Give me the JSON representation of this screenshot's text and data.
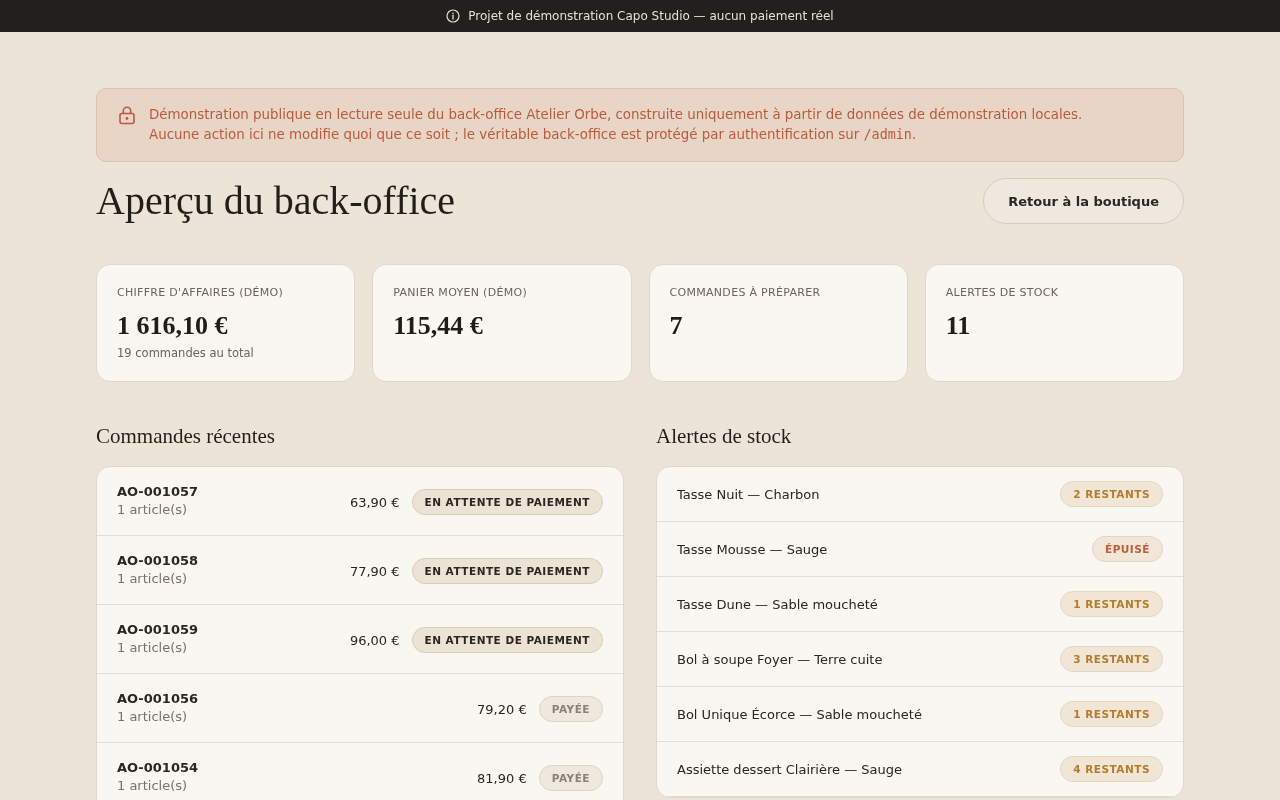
{
  "banner": {
    "text": "Projet de démonstration Capo Studio — aucun paiement réel"
  },
  "notice": {
    "lines": [
      {
        "text": "Démonstration publique en lecture seule du back-office Atelier Orbe, construite uniquement à partir de données de démonstration locales."
      },
      {
        "text": "Aucune action ici ne modifie quoi que ce soit ; le véritable back-office est protégé par authentification sur ",
        "code": "/admin",
        "end": "."
      }
    ]
  },
  "header": {
    "title": "Aperçu du back-office",
    "back_button": "Retour à la boutique"
  },
  "stats": [
    {
      "label": "CHIFFRE D'AFFAIRES (DÉMO)",
      "value": "1 616,10 €",
      "note": "19 commandes au total"
    },
    {
      "label": "PANIER MOYEN (DÉMO)",
      "value": "115,44 €"
    },
    {
      "label": "COMMANDES À PRÉPARER",
      "value": "7"
    },
    {
      "label": "ALERTES DE STOCK",
      "value": "11"
    }
  ],
  "recent_orders": {
    "title": "Commandes récentes",
    "rows": [
      {
        "id": "AO-001057",
        "items": "1 article(s)",
        "amount": "63,90 €",
        "status": {
          "label": "EN ATTENTE DE PAIEMENT",
          "kind": "pending"
        }
      },
      {
        "id": "AO-001058",
        "items": "1 article(s)",
        "amount": "77,90 €",
        "status": {
          "label": "EN ATTENTE DE PAIEMENT",
          "kind": "pending"
        }
      },
      {
        "id": "AO-001059",
        "items": "1 article(s)",
        "amount": "96,00 €",
        "status": {
          "label": "EN ATTENTE DE PAIEMENT",
          "kind": "pending"
        }
      },
      {
        "id": "AO-001056",
        "items": "1 article(s)",
        "amount": "79,20 €",
        "status": {
          "label": "PAYÉE",
          "kind": "paid"
        }
      },
      {
        "id": "AO-001054",
        "items": "1 article(s)",
        "amount": "81,90 €",
        "status": {
          "label": "PAYÉE",
          "kind": "paid"
        }
      }
    ]
  },
  "stock_alerts": {
    "title": "Alertes de stock",
    "rows": [
      {
        "name": "Tasse Nuit — Charbon",
        "badge": {
          "label": "2 RESTANTS",
          "kind": "low"
        }
      },
      {
        "name": "Tasse Mousse — Sauge",
        "badge": {
          "label": "ÉPUISÉ",
          "kind": "out"
        }
      },
      {
        "name": "Tasse Dune — Sable moucheté",
        "badge": {
          "label": "1 RESTANTS",
          "kind": "low"
        }
      },
      {
        "name": "Bol à soupe Foyer — Terre cuite",
        "badge": {
          "label": "3 RESTANTS",
          "kind": "low"
        }
      },
      {
        "name": "Bol Unique Écorce — Sable moucheté",
        "badge": {
          "label": "1 RESTANTS",
          "kind": "low"
        }
      },
      {
        "name": "Assiette dessert Clairière — Sauge",
        "badge": {
          "label": "4 RESTANTS",
          "kind": "low"
        }
      }
    ]
  }
}
